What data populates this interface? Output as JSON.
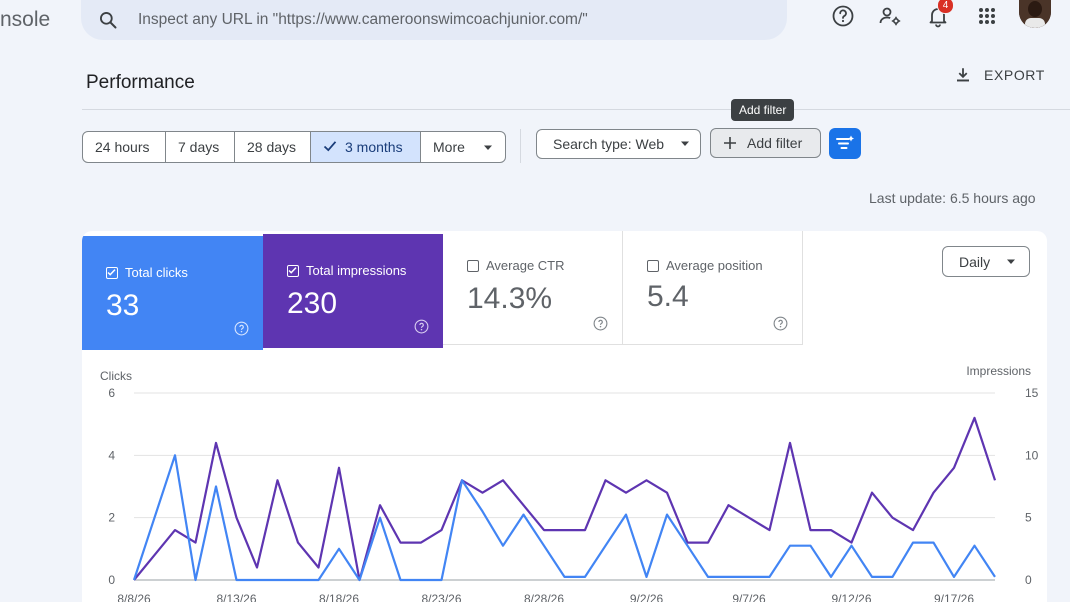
{
  "header": {
    "brand": "nsole",
    "search_placeholder": "Inspect any URL in \"https://www.cameroonswimcoachjunior.com/\"",
    "notifications_count": "4"
  },
  "page": {
    "title": "Performance",
    "export_label": "EXPORT",
    "tooltip": "Add filter",
    "last_update": "Last update: 6.5 hours ago"
  },
  "date_range": {
    "options": [
      "24 hours",
      "7 days",
      "28 days",
      "3 months",
      "More"
    ],
    "selected": "3 months"
  },
  "filters": {
    "search_type": "Search type: Web",
    "add_filter": "Add filter"
  },
  "metrics": [
    {
      "label": "Total clicks",
      "value": "33",
      "checked": true,
      "color": "#4285f4"
    },
    {
      "label": "Total impressions",
      "value": "230",
      "checked": true,
      "color": "#5e35b1"
    },
    {
      "label": "Average CTR",
      "value": "14.3%",
      "checked": false
    },
    {
      "label": "Average position",
      "value": "5.4",
      "checked": false
    }
  ],
  "granularity": "Daily",
  "chart_data": {
    "type": "line",
    "y_left_label": "Clicks",
    "y_right_label": "Impressions",
    "y_left_ticks": [
      "6",
      "4",
      "2",
      "0"
    ],
    "y_right_ticks": [
      "15",
      "10",
      "5",
      "0"
    ],
    "ylim_left": [
      0,
      6
    ],
    "ylim_right": [
      0,
      15
    ],
    "x_tick_labels": [
      "8/8/26",
      "8/13/26",
      "8/18/26",
      "8/23/26",
      "8/28/26",
      "9/2/26",
      "9/7/26",
      "9/12/26",
      "9/17/26"
    ],
    "grid": true,
    "series": [
      {
        "name": "Clicks",
        "axis": "left",
        "color": "#4285f4",
        "values": [
          0,
          2,
          4,
          0,
          3,
          0,
          0,
          0,
          0,
          0,
          1,
          0,
          2,
          0,
          0,
          0,
          3.2,
          2.2,
          1.1,
          2.1,
          1.1,
          0.1,
          0.1,
          1.1,
          2.1,
          0.1,
          2.1,
          1.1,
          0.1,
          0.1,
          0.1,
          0.1,
          1.1,
          1.1,
          0.1,
          1.1,
          0.1,
          0.1,
          1.2,
          1.2,
          0.1,
          1.1,
          0.1
        ]
      },
      {
        "name": "Impressions",
        "axis": "right",
        "color": "#5e35b1",
        "values": [
          0,
          2,
          4,
          3,
          11,
          5,
          1,
          8,
          3,
          1,
          9,
          0,
          6,
          3,
          3,
          4,
          8,
          7,
          8,
          6,
          4,
          4,
          4,
          8,
          7,
          8,
          7,
          3,
          3,
          6,
          5,
          4,
          11,
          4,
          4,
          3,
          7,
          5,
          4,
          7,
          9,
          13,
          8
        ]
      }
    ]
  }
}
